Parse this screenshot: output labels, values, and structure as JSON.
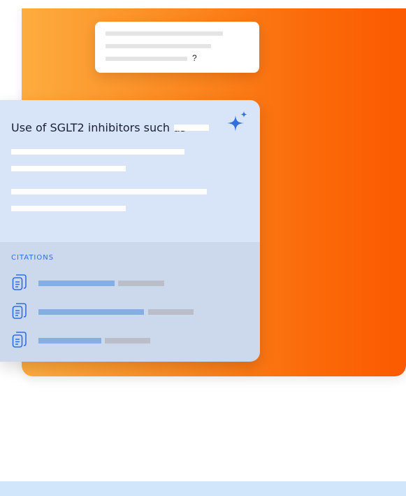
{
  "query_card": {
    "suffix": "?"
  },
  "answer_card": {
    "title": "Use of SGLT2 inhibitors such as",
    "icon": "sparkle-icon"
  },
  "citations": {
    "label": "CITATIONS",
    "icon": "document-icon",
    "count": 3
  },
  "colors": {
    "gradient_start": "#fdac3f",
    "gradient_end": "#fb5a00",
    "accent_blue": "#2f6fe0"
  }
}
